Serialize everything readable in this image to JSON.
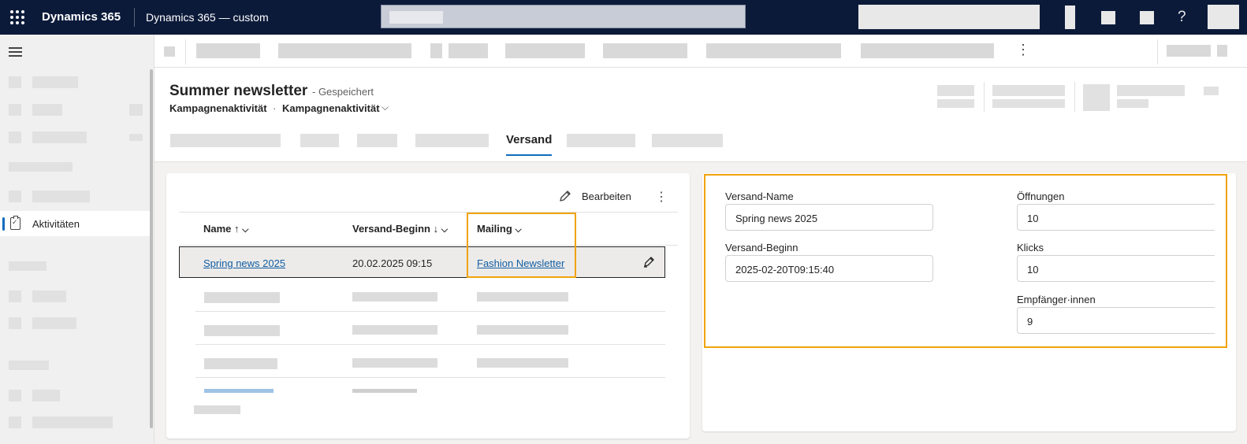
{
  "topbar": {
    "brand": "Dynamics 365",
    "app_name": "Dynamics 365 — custom",
    "help_glyph": "?",
    "icons": [
      "waffle-icon",
      "help-icon"
    ]
  },
  "sidebar": {
    "active_item": "Aktivitäten"
  },
  "record": {
    "title": "Summer newsletter",
    "save_status": "- Gespeichert",
    "entity_type": "Kampagnenaktivität",
    "separator": "·",
    "form_name": "Kampagnenaktivität",
    "chevron": "⌵",
    "active_tab": "Versand"
  },
  "grid": {
    "edit_label": "Bearbeiten",
    "more_glyph": "⋮",
    "columns": [
      {
        "label": "Name",
        "sort": "↑",
        "chevron": "⌵"
      },
      {
        "label": "Versand-Beginn",
        "sort": "↓",
        "chevron": "⌵"
      },
      {
        "label": "Mailing",
        "sort": "",
        "chevron": "⌵"
      }
    ],
    "rows": [
      {
        "name": "Spring news 2025",
        "start": "20.02.2025 09:15",
        "mailing": "Fashion Newsletter"
      }
    ]
  },
  "details": {
    "name_label": "Versand-Name",
    "name_value": "Spring news 2025",
    "start_label": "Versand-Beginn",
    "start_value": "2025-02-20T09:15:40",
    "opens_label": "Öffnungen",
    "opens_value": "10",
    "clicks_label": "Klicks",
    "clicks_value": "10",
    "recipients_label": "Empfänger·innen",
    "recipients_value": "9"
  },
  "colors": {
    "topbar_bg": "#0c1a3a",
    "accent": "#0f6cbd",
    "highlight": "#f0a30a",
    "link": "#115ea3"
  }
}
